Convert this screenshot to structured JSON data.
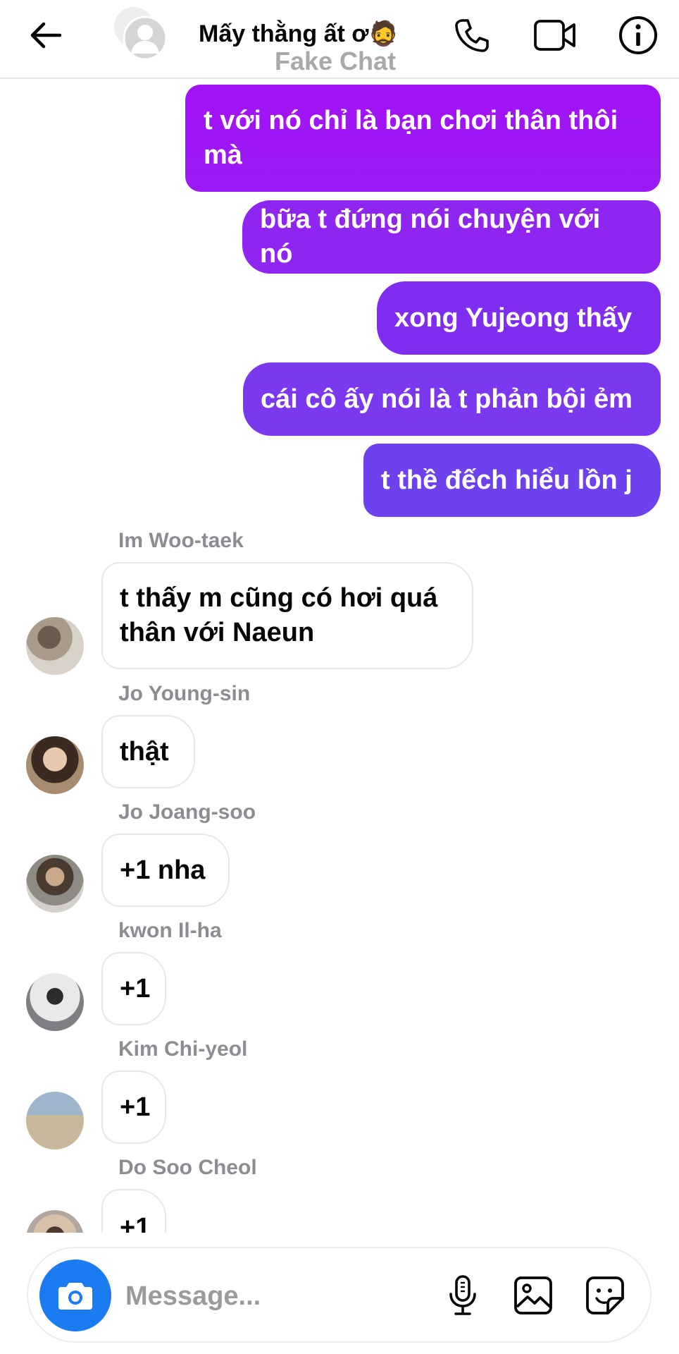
{
  "header": {
    "title": "Mấy thằng ất ơ🧔",
    "watermark": "Fake Chat",
    "back_icon": "arrow-left-icon",
    "call_icon": "phone-icon",
    "video_icon": "video-camera-icon",
    "info_icon": "info-icon"
  },
  "outgoing": [
    {
      "text": "t với nó chỉ là bạn chơi thân thôi mà"
    },
    {
      "text": "bữa t đứng nói chuyện với nó"
    },
    {
      "text": "xong Yujeong thấy"
    },
    {
      "text": "cái cô ấy nói là t phản bội ẻm"
    },
    {
      "text": "t thề đếch hiểu lồn j"
    }
  ],
  "incoming": [
    {
      "sender": "Im Woo-taek",
      "text": "t thấy m cũng có hơi quá thân với Naeun"
    },
    {
      "sender": "Jo Young-sin",
      "text": "thật"
    },
    {
      "sender": "Jo Joang-soo",
      "text": "+1 nha"
    },
    {
      "sender": "kwon Il-ha",
      "text": "+1"
    },
    {
      "sender": "Kim Chi-yeol",
      "text": "+1"
    },
    {
      "sender": "Do Soo Cheol",
      "text": "+1"
    }
  ],
  "composer": {
    "placeholder": "Message...",
    "camera_icon": "camera-icon",
    "mic_icon": "microphone-icon",
    "gallery_icon": "image-icon",
    "sticker_icon": "sticker-icon"
  },
  "colors": {
    "accent": "#1a7cf0",
    "outgoing_top": "#a212f6",
    "outgoing_bottom": "#6d42ee",
    "sender_name": "#8a8d91"
  }
}
